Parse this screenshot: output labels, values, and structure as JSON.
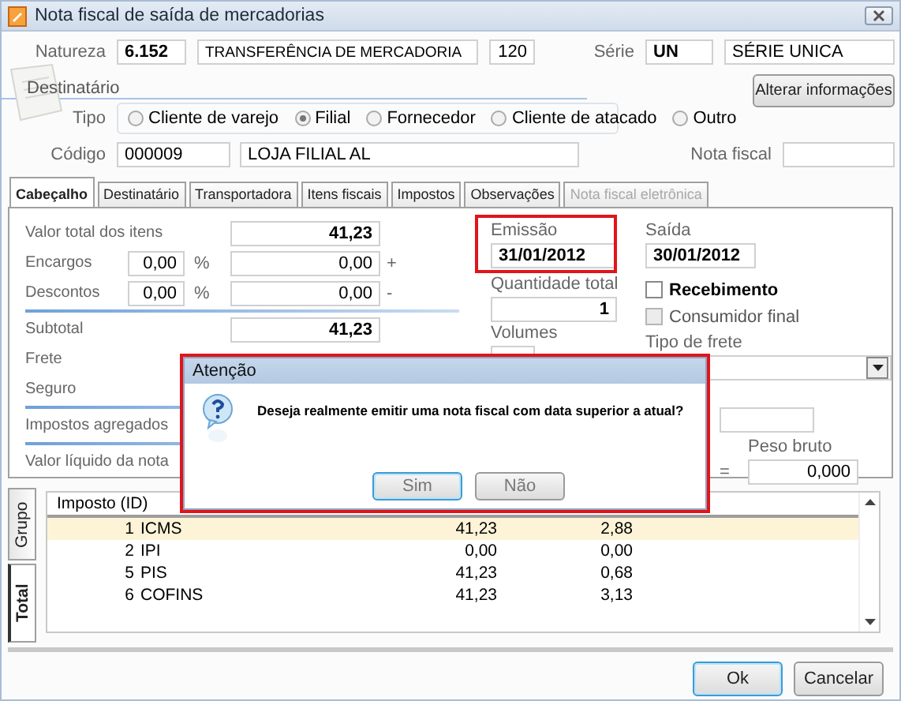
{
  "window": {
    "title": "Nota fiscal de saída de mercadorias"
  },
  "header": {
    "natureza": {
      "label": "Natureza",
      "code": "6.152",
      "description": "TRANSFERÊNCIA DE MERCADORIA",
      "number": "120"
    },
    "serie": {
      "label": "Série",
      "code": "UN",
      "description": "SÉRIE UNICA"
    },
    "group_label": "Destinatário",
    "alter_button": "Alterar informações",
    "tipo": {
      "label": "Tipo",
      "options": [
        {
          "label": "Cliente de varejo",
          "selected": false
        },
        {
          "label": "Filial",
          "selected": true
        },
        {
          "label": "Fornecedor",
          "selected": false
        },
        {
          "label": "Cliente de atacado",
          "selected": false
        },
        {
          "label": "Outro",
          "selected": false
        }
      ]
    },
    "codigo": {
      "label": "Código",
      "code": "000009",
      "name": "LOJA FILIAL AL"
    },
    "nota_fiscal": {
      "label": "Nota fiscal"
    }
  },
  "tabs": [
    {
      "label": "Cabeçalho",
      "selected": true,
      "disabled": false
    },
    {
      "label": "Destinatário",
      "selected": false,
      "disabled": false
    },
    {
      "label": "Transportadora",
      "selected": false,
      "disabled": false
    },
    {
      "label": "Itens fiscais",
      "selected": false,
      "disabled": false
    },
    {
      "label": "Impostos",
      "selected": false,
      "disabled": false
    },
    {
      "label": "Observações",
      "selected": false,
      "disabled": false
    },
    {
      "label": "Nota fiscal eletrônica",
      "selected": false,
      "disabled": true
    }
  ],
  "totals": [
    {
      "kind": "field",
      "label": "Valor total dos itens",
      "value": "41,23",
      "bold": true
    },
    {
      "kind": "field",
      "label": "Encargos",
      "percent": "0,00",
      "percent_sign": "%",
      "value": "0,00",
      "sign": "+",
      "bold": false
    },
    {
      "kind": "field",
      "label": "Descontos",
      "percent": "0,00",
      "percent_sign": "%",
      "value": "0,00",
      "sign": "-",
      "bold": false
    },
    {
      "kind": "divider"
    },
    {
      "kind": "field",
      "label": "Subtotal",
      "value": "41,23",
      "bold": true
    },
    {
      "kind": "field",
      "label": "Frete"
    },
    {
      "kind": "field",
      "label": "Seguro"
    },
    {
      "kind": "divider"
    },
    {
      "kind": "field",
      "label": "Impostos agregados"
    },
    {
      "kind": "divider"
    },
    {
      "kind": "field",
      "label": "Valor líquido da nota"
    }
  ],
  "emissao": {
    "label": "Emissão",
    "value": "31/01/2012",
    "highlighted": true
  },
  "quantidade": {
    "label": "Quantidade total",
    "value": "1"
  },
  "volumes": {
    "label": "Volumes"
  },
  "saida": {
    "label": "Saída",
    "value": "30/01/2012"
  },
  "checks": [
    {
      "label": "Recebimento",
      "checked": false,
      "disabled": false,
      "bold": true
    },
    {
      "label": "Consumidor final",
      "checked": false,
      "disabled": true,
      "bold": false
    }
  ],
  "tipo_frete": {
    "label": "Tipo de frete"
  },
  "peso_bruto": {
    "label": "Peso bruto",
    "value": "0,000",
    "operator": "="
  },
  "bottom": {
    "side_tabs": [
      {
        "label": "Grupo",
        "selected": false
      },
      {
        "label": "Total",
        "selected": true
      }
    ],
    "table": {
      "columns": [
        "Imposto (ID)"
      ],
      "rows": [
        {
          "cells": [
            "1",
            "ICMS",
            "41,23",
            "2,88"
          ],
          "selected": true
        },
        {
          "cells": [
            "2",
            "IPI",
            "0,00",
            "0,00"
          ],
          "selected": false
        },
        {
          "cells": [
            "5",
            "PIS",
            "41,23",
            "0,68"
          ],
          "selected": false
        },
        {
          "cells": [
            "6",
            "COFINS",
            "41,23",
            "3,13"
          ],
          "selected": false
        }
      ]
    }
  },
  "dialog": {
    "title": "Atenção",
    "message": "Deseja realmente emitir uma nota fiscal com data superior a atual?",
    "highlighted": true,
    "buttons": [
      {
        "label": "Sim",
        "focused": true
      },
      {
        "label": "Não",
        "focused": false
      }
    ]
  },
  "buttons": [
    {
      "label": "Ok",
      "focused": true
    },
    {
      "label": "Cancelar",
      "focused": false
    }
  ]
}
